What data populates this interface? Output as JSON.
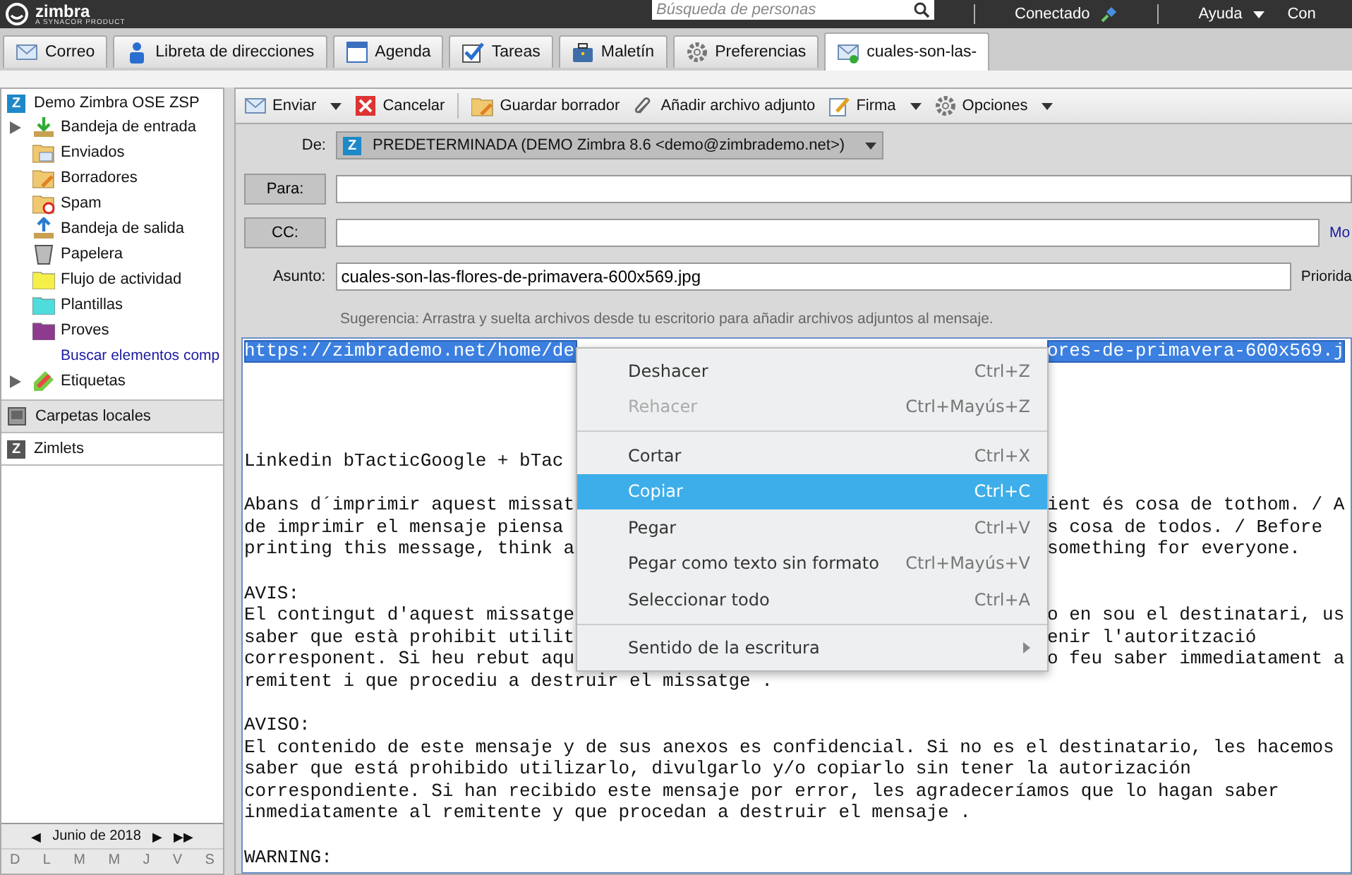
{
  "top_bar": {
    "logo": "zimbra",
    "logo_tagline": "A SYNACOR PRODUCT",
    "search": {
      "placeholder": "Búsqueda de personas"
    },
    "status": "Conectado",
    "help": "Ayuda",
    "account": "Con"
  },
  "tabs": [
    {
      "label": "Correo",
      "kind": "mail",
      "selected": false
    },
    {
      "label": "Libreta de direcciones",
      "kind": "contacts",
      "selected": false
    },
    {
      "label": "Agenda",
      "kind": "calendar",
      "selected": false
    },
    {
      "label": "Tareas",
      "kind": "tasks",
      "selected": false
    },
    {
      "label": "Maletín",
      "kind": "briefcase",
      "selected": false
    },
    {
      "label": "Preferencias",
      "kind": "gear",
      "selected": false
    },
    {
      "label": "cuales-son-las-",
      "kind": "compose",
      "selected": true
    }
  ],
  "sidebar": {
    "account_badge": "Z",
    "account": "Demo Zimbra OSE ZSP",
    "items": [
      {
        "label": "Bandeja de entrada",
        "kind": "inbox",
        "expanded": false
      },
      {
        "label": "Enviados",
        "kind": "sent"
      },
      {
        "label": "Borradores",
        "kind": "drafts"
      },
      {
        "label": "Spam",
        "kind": "spam"
      },
      {
        "label": "Bandeja de salida",
        "kind": "outbox"
      },
      {
        "label": "Papelera",
        "kind": "trash"
      },
      {
        "label": "Flujo de actividad",
        "kind": "folder",
        "color": "#f5ef4a"
      },
      {
        "label": "Plantillas",
        "kind": "folder",
        "color": "#4fdcdc"
      },
      {
        "label": "Proves",
        "kind": "folder",
        "color": "#8e3a8e"
      },
      {
        "label": "Buscar elementos comp",
        "kind": "link"
      },
      {
        "label": "Etiquetas",
        "kind": "tags",
        "expanded": false
      }
    ],
    "sections": [
      {
        "label": "Carpetas locales",
        "kind": "local"
      },
      {
        "label": "Zimlets",
        "kind": "zimlets",
        "badge": "Z"
      }
    ],
    "calendar": {
      "prev": "◀",
      "month": "Junio de 2018",
      "next": "▶",
      "next_year": "▶▶",
      "days": [
        "D",
        "L",
        "M",
        "M",
        "J",
        "V",
        "S"
      ]
    }
  },
  "toolbar": [
    {
      "label": "Enviar",
      "kind": "send",
      "dropdown": true
    },
    {
      "label": "Cancelar",
      "kind": "cancel",
      "dropdown": false
    },
    {
      "label": "Guardar borrador",
      "kind": "save",
      "dropdown": false
    },
    {
      "label": "Añadir archivo adjunto",
      "kind": "attach",
      "dropdown": false
    },
    {
      "label": "Firma",
      "kind": "signature",
      "dropdown": true
    },
    {
      "label": "Opciones",
      "kind": "options",
      "dropdown": true
    }
  ],
  "compose": {
    "from_label": "De:",
    "from_badge": "Z",
    "from_value": "PREDETERMINADA (DEMO Zimbra 8.6 <demo@zimbrademo.net>)",
    "to_button": "Para:",
    "cc_button": "CC:",
    "more_link": "Mo",
    "subject_label": "Asunto:",
    "subject": "cuales-son-las-flores-de-primavera-600x569.jpg",
    "priority_label": "Priorida",
    "hint": "Sugerencia: Arrastra y suelta archivos desde tu escritorio para añadir archivos adjuntos al mensaje.",
    "body": [
      {
        "kind": "text",
        "left": "https://zimbrademo.net/home/de",
        "right": "ores-de-primavera-600x569.j",
        "selected": true
      },
      {
        "kind": "blank"
      },
      {
        "kind": "blank"
      },
      {
        "kind": "blank"
      },
      {
        "kind": "blank"
      },
      {
        "kind": "text",
        "left": "Linkedin bTacticGoogle + bTac",
        "selected": false
      },
      {
        "kind": "blank"
      },
      {
        "kind": "text",
        "left": "Abans d´imprimir aquest missat",
        "right": "ient és cosa de tothom. / A",
        "selected": false
      },
      {
        "kind": "text",
        "left": "de imprimir el mensaje piensa",
        "right": "s cosa de todos. / Before",
        "selected": false
      },
      {
        "kind": "text",
        "left": "printing this message, think a",
        "right": "something for everyone.",
        "selected": false
      },
      {
        "kind": "blank"
      },
      {
        "kind": "text",
        "left": "AVIS:",
        "selected": false
      },
      {
        "kind": "text",
        "left": "El contingut d'aquest missatge",
        "right": "o en sou el destinatari, us",
        "selected": false
      },
      {
        "kind": "text",
        "left": "saber que està prohibit utilit",
        "right": "enir l'autorització",
        "selected": false
      },
      {
        "kind": "text",
        "left": "corresponent. Si heu rebut aqu",
        "right": "o feu saber immediatament a",
        "selected": false
      },
      {
        "kind": "text",
        "left": "remitent i que procediu a destruir el missatge .",
        "selected": false
      },
      {
        "kind": "blank"
      },
      {
        "kind": "text",
        "left": "AVISO:",
        "selected": false
      },
      {
        "kind": "text",
        "left": "El contenido de este mensaje y de sus anexos es confidencial. Si no es el destinatario, les hacemos",
        "selected": false
      },
      {
        "kind": "text",
        "left": "saber que está prohibido utilizarlo, divulgarlo y/o copiarlo sin tener la autorización",
        "selected": false
      },
      {
        "kind": "text",
        "left": "correspondiente. Si han recibido este mensaje por error, les agradeceríamos que lo hagan saber",
        "selected": false
      },
      {
        "kind": "text",
        "left": "inmediatamente al remitente y que procedan a destruir el mensaje .",
        "selected": false
      },
      {
        "kind": "blank"
      },
      {
        "kind": "text",
        "left": "WARNING:",
        "selected": false
      }
    ]
  },
  "context_menu": [
    {
      "label": "Deshacer",
      "shortcut": "Ctrl+Z",
      "kind": "item",
      "disabled": false,
      "selected": false
    },
    {
      "label": "Rehacer",
      "shortcut": "Ctrl+Mayús+Z",
      "kind": "item",
      "disabled": true,
      "selected": false
    },
    {
      "kind": "separator"
    },
    {
      "label": "Cortar",
      "shortcut": "Ctrl+X",
      "kind": "item",
      "disabled": false,
      "selected": false
    },
    {
      "label": "Copiar",
      "shortcut": "Ctrl+C",
      "kind": "item",
      "disabled": false,
      "selected": true
    },
    {
      "label": "Pegar",
      "shortcut": "Ctrl+V",
      "kind": "item",
      "disabled": false,
      "selected": false
    },
    {
      "label": "Pegar como texto sin formato",
      "shortcut": "Ctrl+Mayús+V",
      "kind": "item",
      "disabled": false,
      "selected": false
    },
    {
      "label": "Seleccionar todo",
      "shortcut": "Ctrl+A",
      "kind": "item",
      "disabled": false,
      "selected": false
    },
    {
      "kind": "separator"
    },
    {
      "label": "Sentido de la escritura",
      "kind": "submenu",
      "disabled": false,
      "selected": false
    }
  ]
}
